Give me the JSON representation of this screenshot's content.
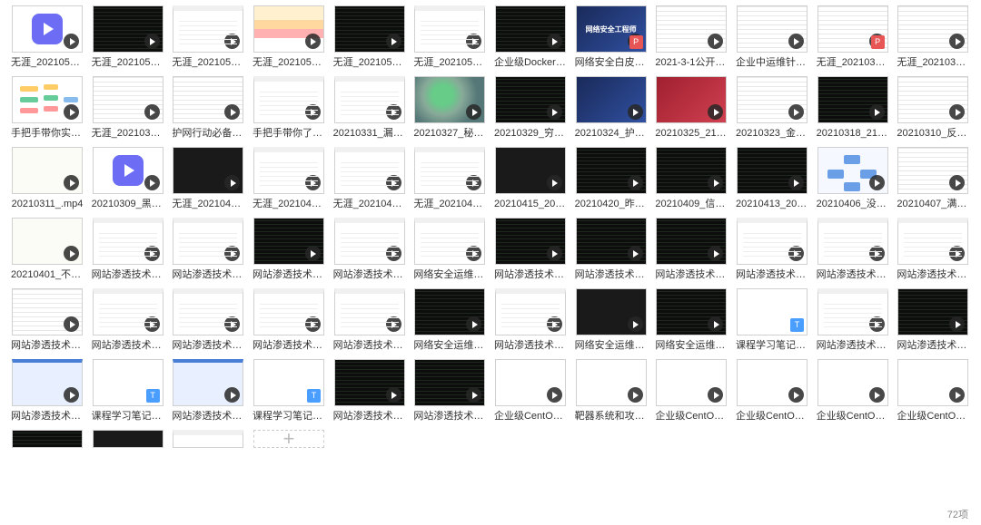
{
  "footer": {
    "count": "72项"
  },
  "items": [
    {
      "name": "无涯_20210520_...",
      "type": "video-icon"
    },
    {
      "name": "无涯_20210521_...",
      "type": "code"
    },
    {
      "name": "无涯_20210522_...",
      "type": "docwin"
    },
    {
      "name": "无涯_20210527_...",
      "type": "colorful"
    },
    {
      "name": "无涯_20210528_...",
      "type": "code"
    },
    {
      "name": "无涯_20210529_...",
      "type": "docwin"
    },
    {
      "name": "企业级Docker容...",
      "type": "code"
    },
    {
      "name": "网络安全白皮书V...",
      "type": "blue",
      "badge": "pdf",
      "text": "网络安全工程师"
    },
    {
      "name": "2021-3-1公开课...",
      "type": "doc"
    },
    {
      "name": "企业中运维针对...",
      "type": "doc"
    },
    {
      "name": "无涯_20210328_...",
      "type": "doc",
      "badge": "pdf"
    },
    {
      "name": "无涯_20210330_...",
      "type": "doc"
    },
    {
      "name": "手把手带你实现...",
      "type": "mind"
    },
    {
      "name": "无涯_20210326_...",
      "type": "doc"
    },
    {
      "name": "护网行动必备技...",
      "type": "doc"
    },
    {
      "name": "手把手带你了解...",
      "type": "docwin"
    },
    {
      "name": "20210331_漏洞...",
      "type": "docwin"
    },
    {
      "name": "20210327_秘钥...",
      "type": "pic"
    },
    {
      "name": "20210329_穷举...",
      "type": "code"
    },
    {
      "name": "20210324_护网...",
      "type": "blue"
    },
    {
      "name": "20210325_21世...",
      "type": "red"
    },
    {
      "name": "20210323_金三...",
      "type": "doc"
    },
    {
      "name": "20210318_21世...",
      "type": "code"
    },
    {
      "name": "20210310_反黑...",
      "type": "doc"
    },
    {
      "name": "20210311_.mp4",
      "type": "form"
    },
    {
      "name": "20210309_黑客...",
      "type": "video-icon"
    },
    {
      "name": "无涯_20210424_...",
      "type": "dark"
    },
    {
      "name": "无涯_20210423_...",
      "type": "docwin"
    },
    {
      "name": "无涯_20210423_...",
      "type": "docwin"
    },
    {
      "name": "无涯_20210402_...",
      "type": "docwin"
    },
    {
      "name": "20210415_2003...",
      "type": "dark"
    },
    {
      "name": "20210420_昨晚...",
      "type": "code"
    },
    {
      "name": "20210409_信不...",
      "type": "code"
    },
    {
      "name": "20210413_2005...",
      "type": "code"
    },
    {
      "name": "20210406_没注...",
      "type": "diagram"
    },
    {
      "name": "20210407_满足...",
      "type": "doc"
    },
    {
      "name": "20210401_不会...",
      "type": "form"
    },
    {
      "name": "网站渗透技术-03...",
      "type": "docwin"
    },
    {
      "name": "网站渗透技术-05...",
      "type": "docwin"
    },
    {
      "name": "网站渗透技术-01...",
      "type": "code"
    },
    {
      "name": "网站渗透技术-06...",
      "type": "docwin"
    },
    {
      "name": "网络安全运维班...",
      "type": "docwin"
    },
    {
      "name": "网站渗透技术-04...",
      "type": "code"
    },
    {
      "name": "网站渗透技术-02...",
      "type": "code"
    },
    {
      "name": "网站渗透技术-02...",
      "type": "code"
    },
    {
      "name": "网站渗透技术-07...",
      "type": "docwin"
    },
    {
      "name": "网站渗透技术-07...",
      "type": "docwin"
    },
    {
      "name": "网站渗透技术-03...",
      "type": "docwin"
    },
    {
      "name": "网站渗透技术-03...",
      "type": "doc"
    },
    {
      "name": "网站渗透技术-10...",
      "type": "docwin"
    },
    {
      "name": "网站渗透技术-08...",
      "type": "docwin"
    },
    {
      "name": "网站渗透技术-09...",
      "type": "docwin"
    },
    {
      "name": "网站渗透技术-06...",
      "type": "docwin"
    },
    {
      "name": "网络安全运维班...",
      "type": "code"
    },
    {
      "name": "网站渗透技术-05...",
      "type": "docwin"
    },
    {
      "name": "网络安全运维班...",
      "type": "dark"
    },
    {
      "name": "网络安全运维班...",
      "type": "code"
    },
    {
      "name": "课程学习笔记.txt",
      "type": "blank",
      "badge": "txt",
      "noplay": true
    },
    {
      "name": "网站渗透技术-01...",
      "type": "docwin"
    },
    {
      "name": "网站渗透技术-04...",
      "type": "code"
    },
    {
      "name": "网站渗透技术-03...",
      "type": "bluewin"
    },
    {
      "name": "课程学习笔记-02...",
      "type": "blank",
      "badge": "txt",
      "noplay": true
    },
    {
      "name": "网站渗透技术-02...",
      "type": "bluewin"
    },
    {
      "name": "课程学习笔记-01...",
      "type": "blank",
      "badge": "txt",
      "noplay": true
    },
    {
      "name": "网站渗透技术-01...",
      "type": "code"
    },
    {
      "name": "网站渗透技术-02...",
      "type": "code"
    },
    {
      "name": "企业级CentOS系...",
      "type": "blank"
    },
    {
      "name": "靶器系统和攻防...",
      "type": "blank"
    },
    {
      "name": "企业级CentOS系...",
      "type": "blank"
    },
    {
      "name": "企业级CentOS系...",
      "type": "blank"
    },
    {
      "name": "企业级CentOS系...",
      "type": "blank"
    },
    {
      "name": "企业级CentOS系...",
      "type": "blank"
    }
  ],
  "partial": [
    {
      "type": "code"
    },
    {
      "type": "dark"
    },
    {
      "type": "docwin"
    }
  ]
}
